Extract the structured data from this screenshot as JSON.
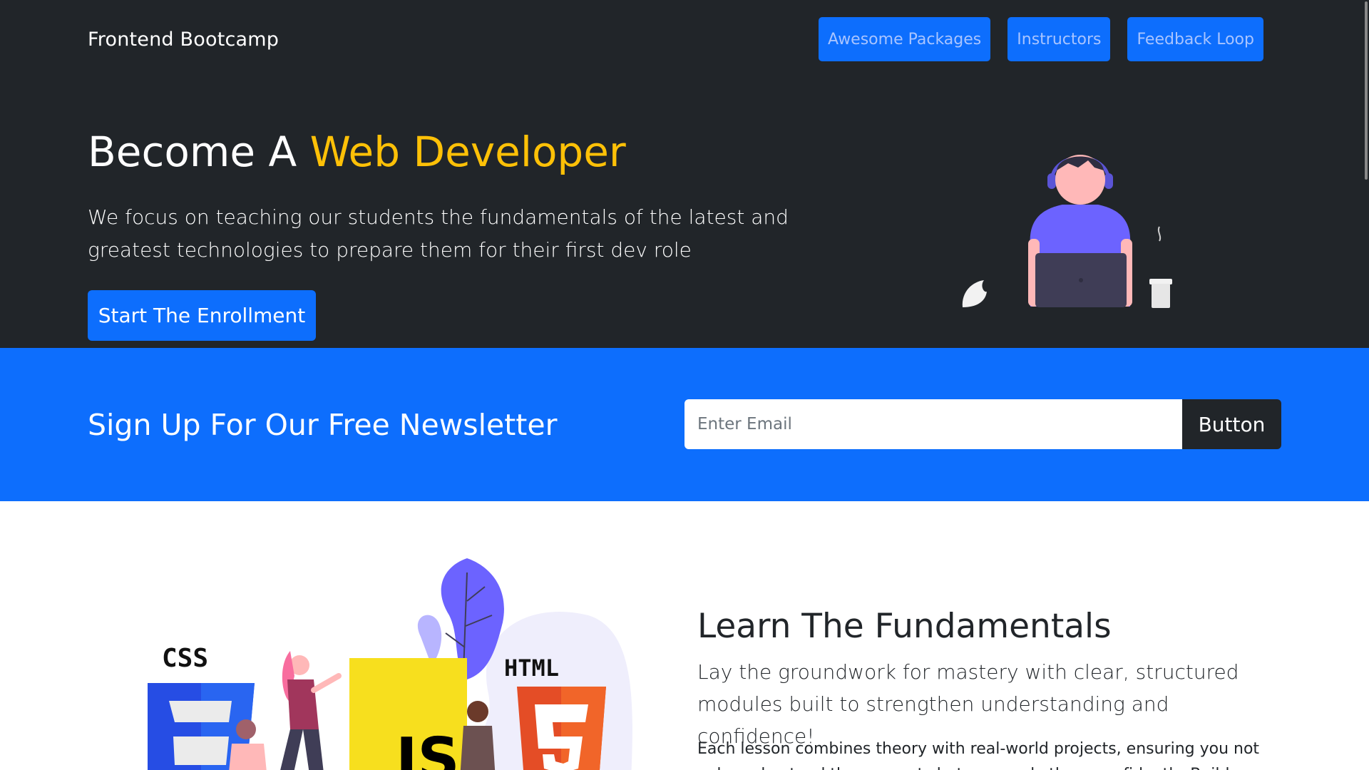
{
  "header": {
    "brand": "Frontend Bootcamp",
    "nav": [
      {
        "label": "Awesome Packages"
      },
      {
        "label": "Instructors"
      },
      {
        "label": "Feedback Loop"
      }
    ]
  },
  "hero": {
    "title_prefix": "Become A ",
    "title_accent": "Web Developer",
    "lead": "We focus on teaching our students the fundamentals of the latest and greatest technologies to prepare them for their first dev role",
    "cta_label": "Start The Enrollment"
  },
  "newsletter": {
    "title": "Sign Up For Our Free Newsletter",
    "email_placeholder": "Enter Email",
    "email_value": "",
    "button_label": "Button"
  },
  "learn": {
    "title": "Learn The Fundamentals",
    "lead": "Lay the groundwork for mastery with clear, structured modules built to strengthen understanding and confidence!",
    "body": "Each lesson combines theory with real-world projects, ensuring you not only understand the concepts but can apply them confidently. Build"
  },
  "illustrations": {
    "css_label": "CSS",
    "html_label": "HTML",
    "js_label": "JS"
  },
  "colors": {
    "dark": "#212529",
    "primary": "#0d6efd",
    "accent": "#ffc107",
    "purple": "#6c63ff"
  }
}
